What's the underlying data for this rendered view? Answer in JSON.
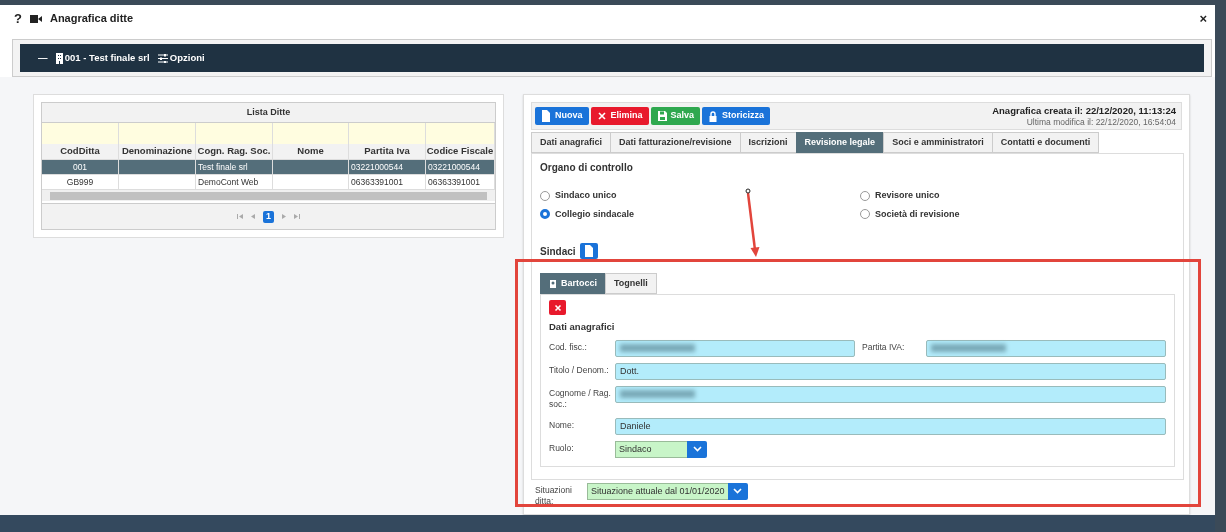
{
  "window": {
    "help": "?",
    "title": "Anagrafica ditte",
    "close": "×"
  },
  "toolbar": {
    "collapse": "—",
    "company": "001 - Test finale srl",
    "options": "Opzioni"
  },
  "company_list": {
    "title": "Lista Ditte",
    "columns": [
      "CodDitta",
      "Denominazione",
      "Cogn. Rag. Soc.",
      "Nome",
      "Partita Iva",
      "Codice Fiscale"
    ],
    "rows": [
      {
        "selected": true,
        "cells": [
          "001",
          "",
          "Test finale srl",
          "",
          "03221000544",
          "03221000544"
        ]
      },
      {
        "selected": false,
        "cells": [
          "GB999",
          "",
          "DemoCont Web",
          "",
          "06363391001",
          "06363391001"
        ]
      }
    ],
    "pager": {
      "pages": [
        {
          "label": "1",
          "selected": true
        }
      ]
    }
  },
  "detail": {
    "buttons": [
      {
        "label": "Nuova",
        "kind": "new"
      },
      {
        "label": "Elimina",
        "kind": "delete"
      },
      {
        "label": "Salva",
        "kind": "save"
      },
      {
        "label": "Storicizza",
        "kind": "archive"
      }
    ],
    "created": "Anagrafica creata il: 22/12/2020, 11:13:24",
    "modified": "Ultima modifica il: 22/12/2020, 16:54:04",
    "tabs": [
      {
        "label": "Dati anagrafici",
        "selected": false
      },
      {
        "label": "Dati fatturazione/revisione",
        "selected": false
      },
      {
        "label": "Iscrizioni",
        "selected": false
      },
      {
        "label": "Revisione legale",
        "selected": true
      },
      {
        "label": "Soci e amministratori",
        "selected": false
      },
      {
        "label": "Contatti e documenti",
        "selected": false
      }
    ],
    "section_title": "Organo di controllo",
    "radios": [
      {
        "label": "Sindaco unico",
        "selected": false
      },
      {
        "label": "Revisore unico",
        "selected": false
      },
      {
        "label": "Collegio sindacale",
        "selected": true
      },
      {
        "label": "Società di revisione",
        "selected": false
      }
    ],
    "members_title": "Sindaci",
    "member_tabs": [
      {
        "label": "Bartocci",
        "selected": true
      },
      {
        "label": "Tognelli",
        "selected": false
      }
    ],
    "member": {
      "section_title": "Dati anagrafici",
      "fields": [
        {
          "kind": "pair",
          "label": "Cod. fisc.:",
          "redacted": true,
          "label2": "Partita IVA:",
          "redacted2": true
        },
        {
          "kind": "text",
          "label": "Titolo / Denom.:",
          "value": "Dott.",
          "redacted": false
        },
        {
          "kind": "text",
          "label": "Cognome / Rag. soc.:",
          "redacted": true
        },
        {
          "kind": "text",
          "label": "Nome:",
          "value": "Daniele",
          "redacted": false
        },
        {
          "kind": "select",
          "label": "Ruolo:",
          "value": "Sindaco"
        }
      ]
    },
    "situation": {
      "label": "Situazioni ditta:",
      "value": "Situazione attuale dal 01/01/2020"
    }
  },
  "annotation": {
    "frame": true,
    "arrow": true
  }
}
